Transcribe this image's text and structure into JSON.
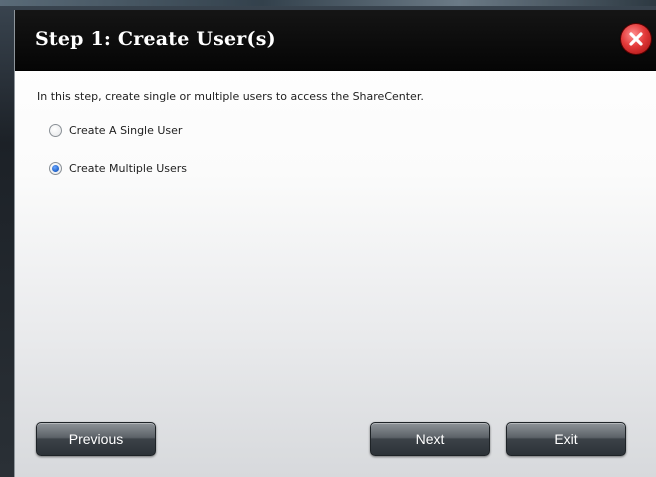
{
  "dialog": {
    "title": "Step 1: Create User(s)",
    "intro": "In this step, create single or multiple users to access the ShareCenter.",
    "options": [
      {
        "label": "Create A Single User",
        "checked": false
      },
      {
        "label": "Create Multiple Users",
        "checked": true
      }
    ],
    "buttons": {
      "previous": "Previous",
      "next": "Next",
      "exit": "Exit"
    }
  },
  "colors": {
    "titlebar": "#0a0a0a",
    "close_button": "#d32a2a",
    "radio_selected": "#1d5fc7"
  },
  "icons": {
    "close": "close-icon"
  }
}
